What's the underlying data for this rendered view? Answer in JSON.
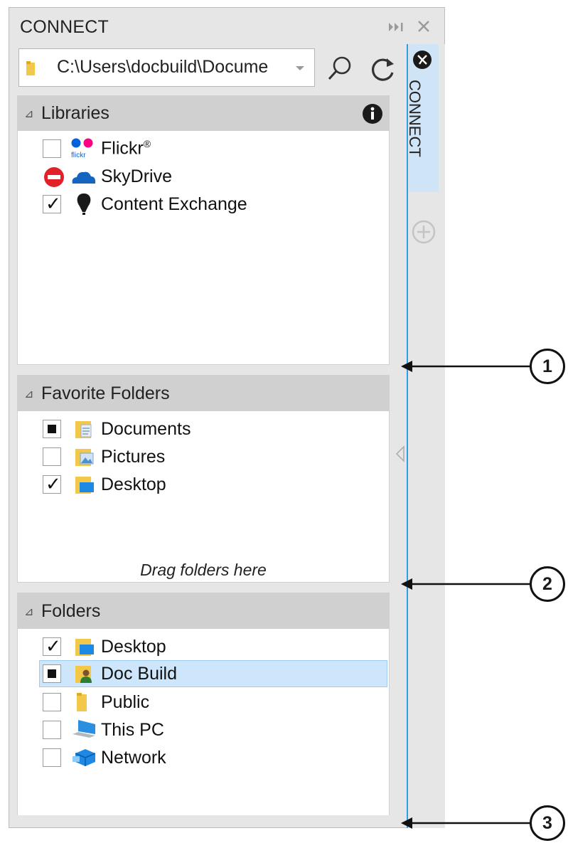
{
  "docker": {
    "title": "CONNECT",
    "path": "C:\\Users\\docbuild\\Docume",
    "tab_label": "CONNECT"
  },
  "libraries": {
    "title": "Libraries",
    "items": [
      {
        "label": "Flickr",
        "mark": "®",
        "checkbox": "unchecked",
        "icon": "flickr-icon"
      },
      {
        "label": "SkyDrive",
        "checkbox": "unavailable",
        "icon": "skydrive-icon"
      },
      {
        "label": "Content Exchange",
        "checkbox": "checked",
        "icon": "content-exchange-icon"
      }
    ]
  },
  "favorites": {
    "title": "Favorite Folders",
    "items": [
      {
        "label": "Documents",
        "checkbox": "partial",
        "icon": "documents-folder-icon"
      },
      {
        "label": "Pictures",
        "checkbox": "unchecked",
        "icon": "pictures-folder-icon"
      },
      {
        "label": "Desktop",
        "checkbox": "checked",
        "icon": "desktop-folder-icon"
      }
    ],
    "hint": "Drag folders here"
  },
  "folders": {
    "title": "Folders",
    "items": [
      {
        "label": "Desktop",
        "checkbox": "checked",
        "icon": "desktop-folder-icon"
      },
      {
        "label": "Doc Build",
        "checkbox": "partial",
        "icon": "user-folder-icon",
        "selected": true
      },
      {
        "label": "Public",
        "checkbox": "unchecked",
        "icon": "folder-icon"
      },
      {
        "label": "This PC",
        "checkbox": "unchecked",
        "icon": "computer-icon"
      },
      {
        "label": "Network",
        "checkbox": "unchecked",
        "icon": "network-icon"
      }
    ]
  },
  "callouts": [
    "1",
    "2",
    "3"
  ],
  "colors": {
    "accent": "#2f9ee6",
    "selection": "#cde6fb",
    "header": "#d0d0d0",
    "frame": "#e6e6e6"
  }
}
